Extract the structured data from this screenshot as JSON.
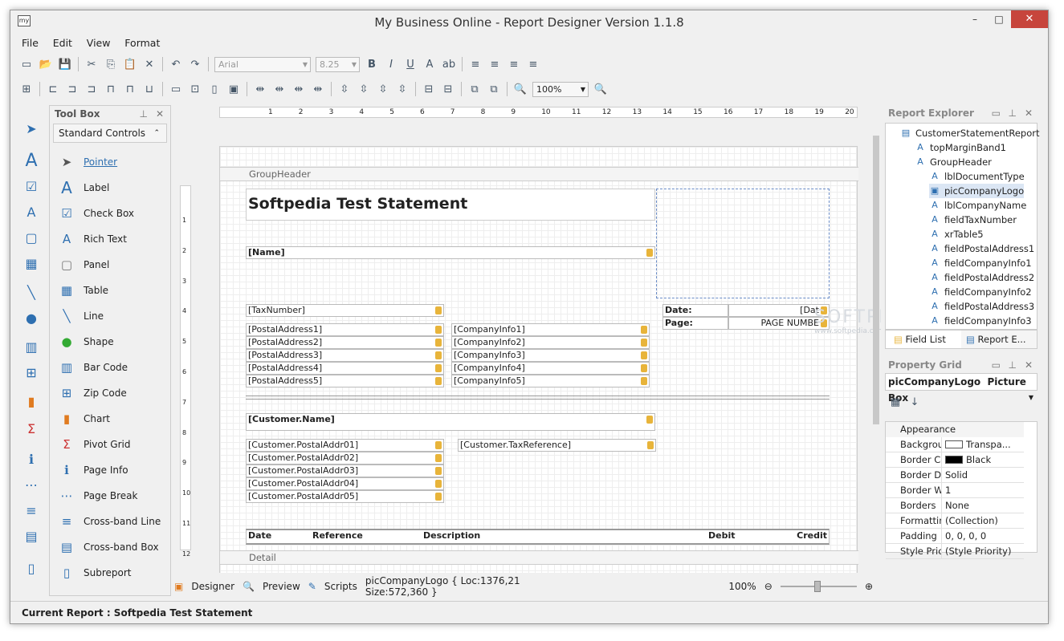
{
  "window": {
    "title": "My Business Online - Report Designer Version 1.1.8",
    "app_icon": "my",
    "minimize": "–",
    "maximize": "□",
    "close": "✕"
  },
  "menu": [
    "File",
    "Edit",
    "View",
    "Format"
  ],
  "format_toolbar": {
    "font": "Arial",
    "size": "8.25",
    "zoom": "100%"
  },
  "toolbox": {
    "title": "Tool Box",
    "group": "Standard Controls",
    "items": [
      "Pointer",
      "Label",
      "Check Box",
      "Rich Text",
      "Panel",
      "Table",
      "Line",
      "Shape",
      "Bar Code",
      "Zip Code",
      "Chart",
      "Pivot Grid",
      "Page Info",
      "Page Break",
      "Cross-band Line",
      "Cross-band Box",
      "Subreport"
    ]
  },
  "ruler_numbers": [
    "1",
    "2",
    "3",
    "4",
    "5",
    "6",
    "7",
    "8",
    "9",
    "10",
    "11",
    "12",
    "13",
    "14",
    "15",
    "16",
    "17",
    "18",
    "19",
    "20"
  ],
  "ruler_left_numbers": [
    "1",
    "2",
    "3",
    "4",
    "5",
    "6",
    "7",
    "8",
    "9",
    "10",
    "11",
    "12"
  ],
  "bands": {
    "group_header": "GroupHeader",
    "detail": "Detail"
  },
  "report": {
    "title": "Softpedia Test Statement",
    "name": "[Name]",
    "tax": "[TaxNumber]",
    "postal": [
      "[PostalAddress1]",
      "[PostalAddress2]",
      "[PostalAddress3]",
      "[PostalAddress4]",
      "[PostalAddress5]"
    ],
    "company": [
      "[CompanyInfo1]",
      "[CompanyInfo2]",
      "[CompanyInfo3]",
      "[CompanyInfo4]",
      "[CompanyInfo5]"
    ],
    "date_label": "Date:",
    "date_value": "[Dat",
    "page_label": "Page:",
    "page_value": "PAGE NUMBE",
    "customer_name": "[Customer.Name]",
    "customer_addr": [
      "[Customer.PostalAddr01]",
      "[Customer.PostalAddr02]",
      "[Customer.PostalAddr03]",
      "[Customer.PostalAddr04]",
      "[Customer.PostalAddr05]"
    ],
    "customer_tax": "[Customer.TaxReference]",
    "table_headers": [
      "Date",
      "Reference",
      "Description",
      "Debit",
      "Credit"
    ]
  },
  "watermark": "SOFTPEDIA",
  "watermark_url": "www.softpedia.com",
  "status": {
    "designer": "Designer",
    "preview": "Preview",
    "scripts": "Scripts",
    "selection": "picCompanyLogo { Loc:1376,21 Size:572,360 }",
    "zoom": "100%"
  },
  "explorer": {
    "title": "Report Explorer",
    "nodes": [
      "CustomerStatementReport",
      "topMarginBand1",
      "GroupHeader",
      "lblDocumentType",
      "picCompanyLogo",
      "lblCompanyName",
      "fieldTaxNumber",
      "xrTable5",
      "fieldPostalAddress1",
      "fieldCompanyInfo1",
      "fieldPostalAddress2",
      "fieldCompanyInfo2",
      "fieldPostalAddress3",
      "fieldCompanyInfo3"
    ],
    "tabs": [
      "Field List",
      "Report E..."
    ]
  },
  "property_grid": {
    "title": "Property Grid",
    "object": "picCompanyLogo",
    "object_type": "Picture Box",
    "category": "Appearance",
    "rows": [
      [
        "Backgroun",
        "Transpa..."
      ],
      [
        "Border Col",
        "Black"
      ],
      [
        "Border Das",
        "Solid"
      ],
      [
        "Border Wic",
        "1"
      ],
      [
        "Borders",
        "None"
      ],
      [
        "Formatting",
        "(Collection)"
      ],
      [
        "Padding",
        "0, 0, 0, 0"
      ],
      [
        "Style Priori",
        "(Style Priority)"
      ]
    ]
  },
  "bottom_status": "Current Report : Softpedia Test Statement",
  "colors": {
    "accent": "#2e6fb0",
    "close": "#c7453c",
    "tag": "#e8b43a"
  }
}
